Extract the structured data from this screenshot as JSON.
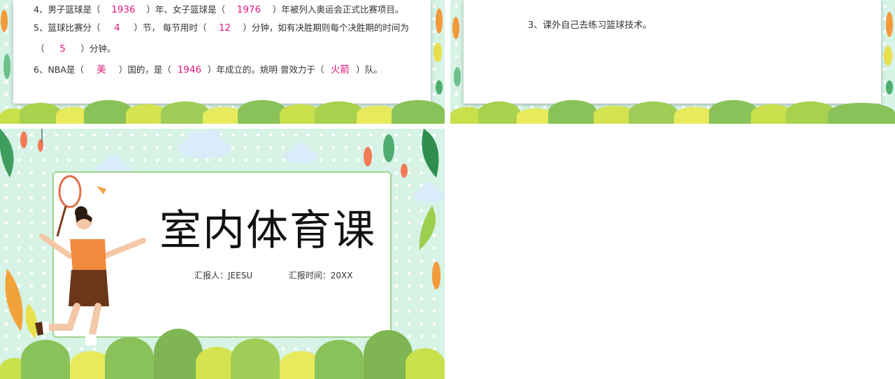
{
  "slides": {
    "quiz": {
      "questions": [
        {
          "prefix": "4、男子篮球是（",
          "a1": "1936",
          "mid": "）年、女子篮球是（",
          "a2": "1976",
          "suffix": "）年被列入奥运会正式比赛项目。"
        },
        {
          "prefix": "5、篮球比赛分（",
          "a1": "4",
          "mid": "）节，  每节用时（",
          "a2": "12",
          "suffix": "）分钟，如有决胜期则每个决胜期的时间为"
        },
        {
          "prefix": "（",
          "a1": "5",
          "suffix": "）分钟。"
        },
        {
          "prefix": "6、NBA是（",
          "a1": "美",
          "mid": "）国的，是（",
          "a2": "1946",
          "mid2": "）年成立的。姚明 曾效力于（",
          "a3": "火箭",
          "suffix": "）队。"
        }
      ]
    },
    "homework": {
      "item": "3、课外自己去练习篮球技术。"
    },
    "cover": {
      "title": "室内体育课",
      "reporter": "汇报人：JEESU",
      "time": "汇报时间：20XX"
    }
  },
  "colors": {
    "answer": "#e4177d",
    "background": "#d6f3e6",
    "card_border": "#9fd58f"
  },
  "icons": [
    "badminton-player-illustration",
    "cloud-icon",
    "shuttlecock-icon",
    "leaf-decoration",
    "bush-decoration"
  ]
}
